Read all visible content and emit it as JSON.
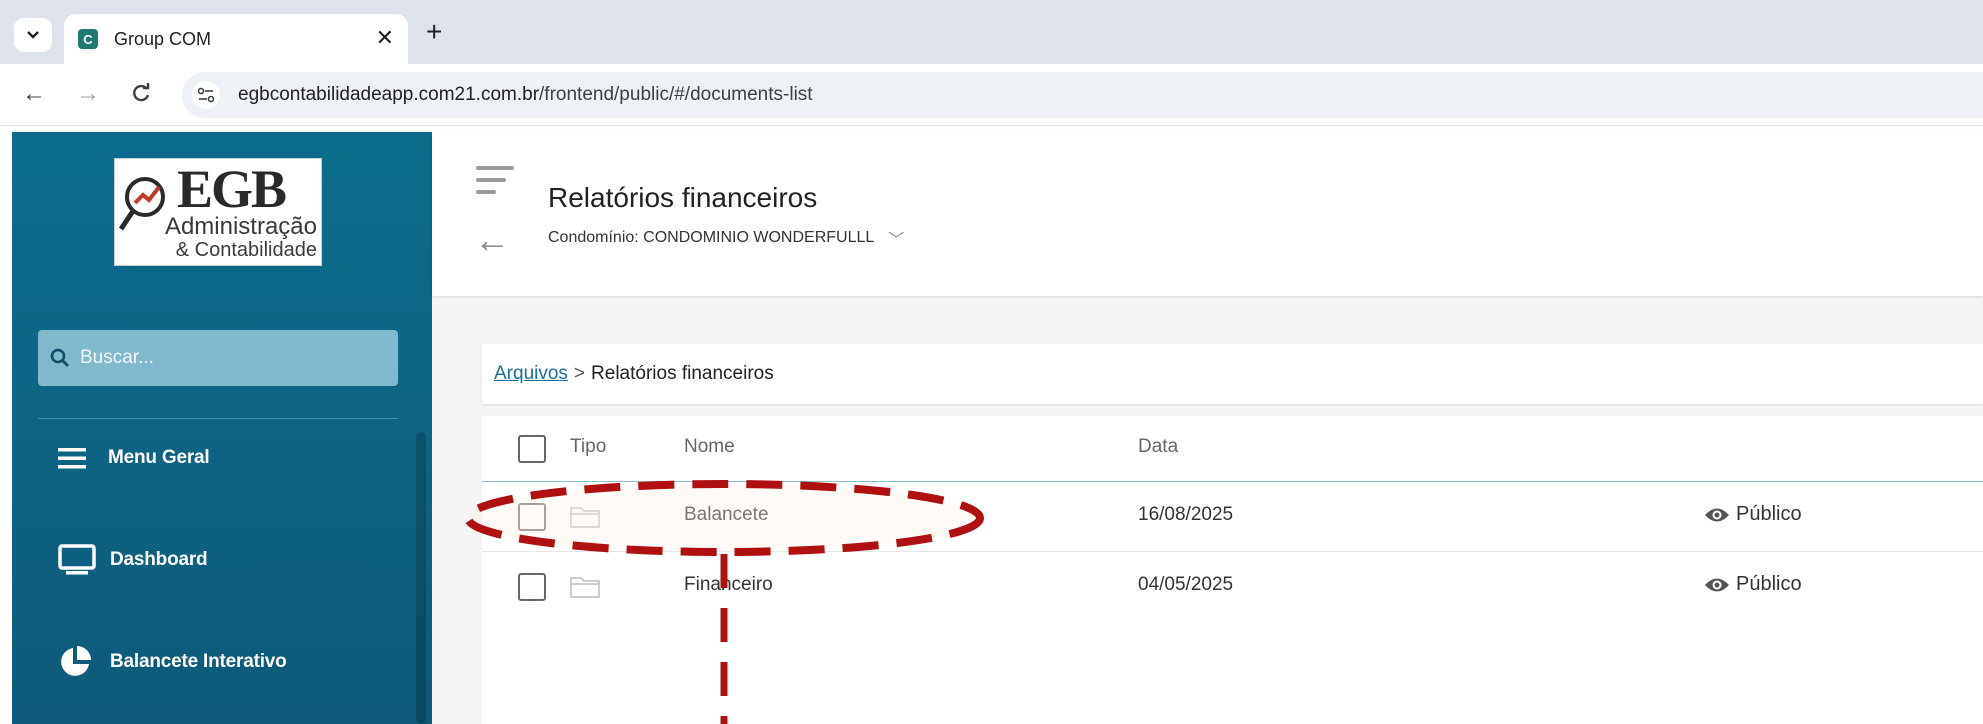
{
  "browser": {
    "tab_title": "Group COM",
    "url_host": "egbcontabilidadeapp.com21.com.br",
    "url_path": "/frontend/public/#/documents-list"
  },
  "sidebar": {
    "logo": {
      "line1": "EGB",
      "line2": "Administração",
      "line3": "& Contabilidade"
    },
    "search_placeholder": "Buscar...",
    "items": [
      {
        "label": "Menu Geral",
        "icon": "hamburger-icon"
      },
      {
        "label": "Dashboard",
        "icon": "monitor-icon"
      },
      {
        "label": "Balancete Interativo",
        "icon": "pie-chart-icon"
      }
    ]
  },
  "header": {
    "title": "Relatórios financeiros",
    "subtitle": "Condomínio: CONDOMINIO WONDERFULLL"
  },
  "breadcrumb": {
    "root": "Arquivos",
    "separator": ">",
    "current": "Relatórios financeiros"
  },
  "table": {
    "columns": {
      "tipo": "Tipo",
      "nome": "Nome",
      "data": "Data"
    },
    "rows": [
      {
        "nome": "Balancete",
        "data": "16/08/2025",
        "visibility": "Público"
      },
      {
        "nome": "Financeiro",
        "data": "04/05/2025",
        "visibility": "Público"
      }
    ]
  },
  "colors": {
    "sidebar": "#0b6c8c",
    "annotation": "#b01010",
    "link": "#1a6fa0"
  }
}
